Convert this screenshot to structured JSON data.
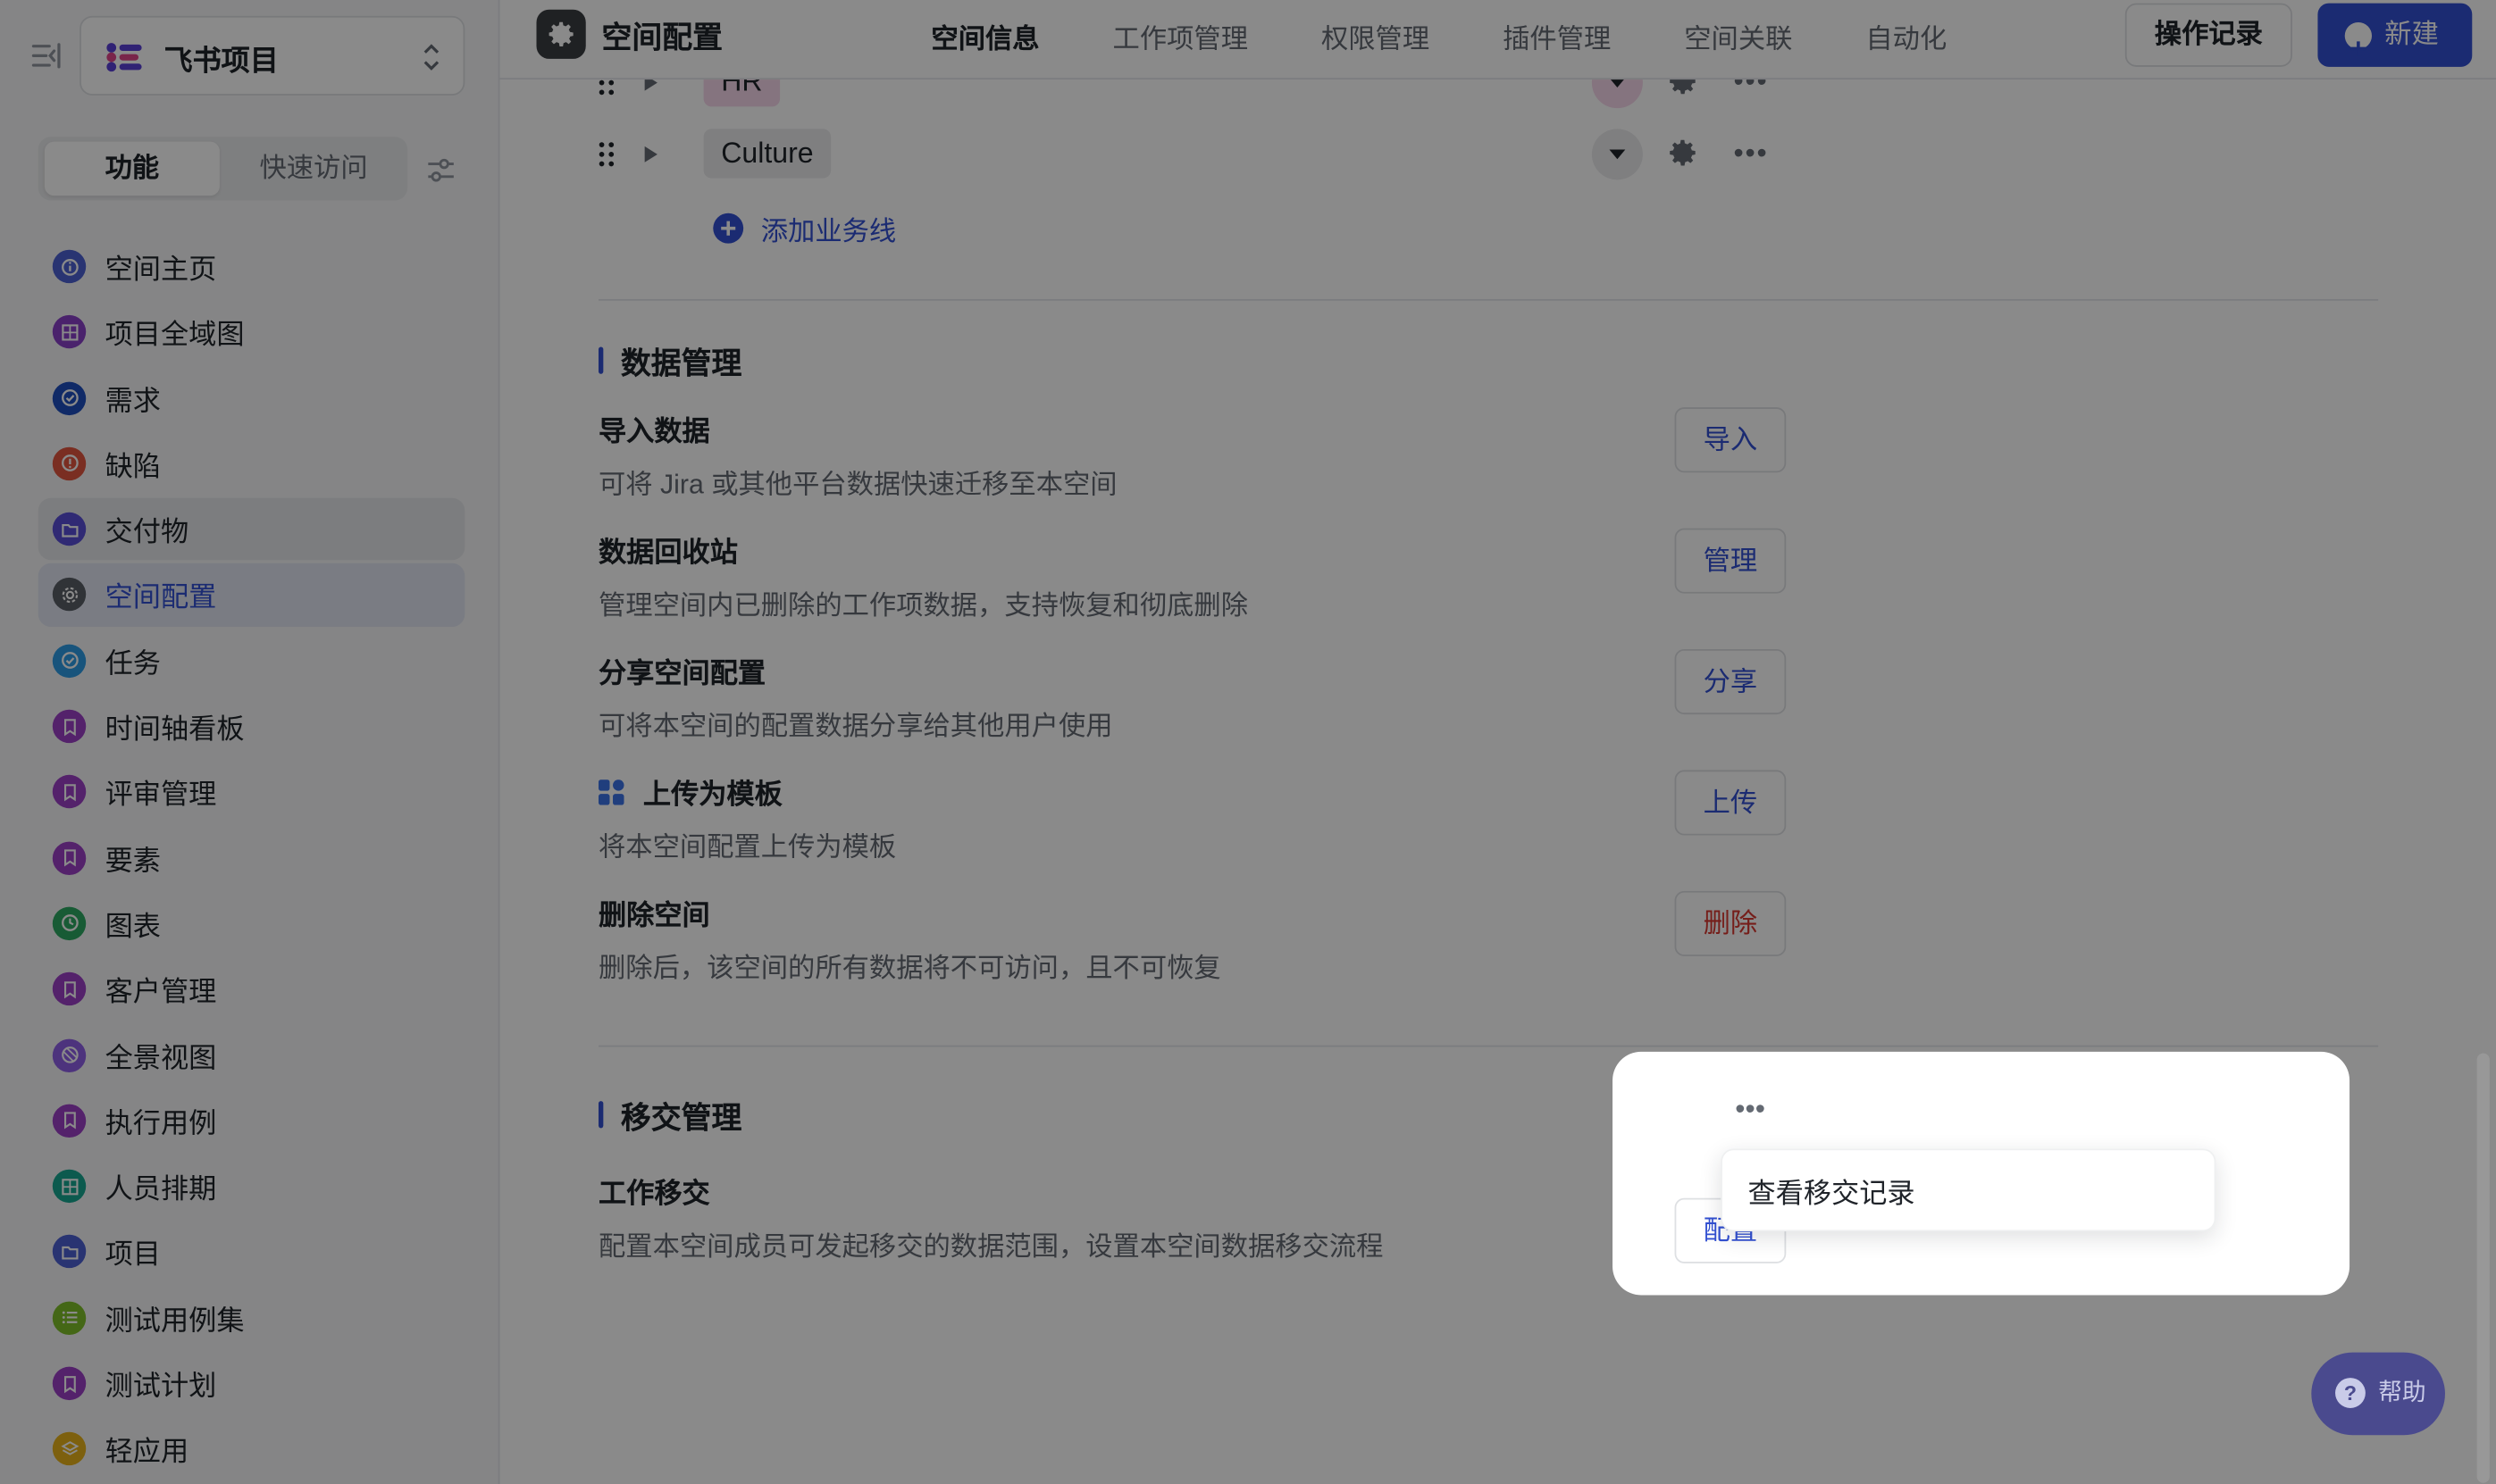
{
  "sidebar": {
    "project_name": "飞书项目",
    "segments": [
      "功能",
      "快速访问"
    ],
    "items": [
      {
        "label": "空间主页",
        "icon": "info-icon",
        "color": "#4d61d3"
      },
      {
        "label": "项目全域图",
        "icon": "grid-icon",
        "color": "#8a3fc8"
      },
      {
        "label": "需求",
        "icon": "check-circle-icon",
        "color": "#1f4fbf"
      },
      {
        "label": "缺陷",
        "icon": "alert-icon",
        "color": "#e2553f"
      },
      {
        "label": "交付物",
        "icon": "folder-icon",
        "color": "#5a4fd6"
      },
      {
        "label": "空间配置",
        "icon": "gear-icon",
        "color": "#5a5e66"
      },
      {
        "label": "任务",
        "icon": "check-circle-icon",
        "color": "#2e9ce6"
      },
      {
        "label": "时间轴看板",
        "icon": "bookmark-icon",
        "color": "#9c3fc6"
      },
      {
        "label": "评审管理",
        "icon": "bookmark-icon",
        "color": "#9c3fc6"
      },
      {
        "label": "要素",
        "icon": "bookmark-icon",
        "color": "#9c3fc6"
      },
      {
        "label": "图表",
        "icon": "clock-icon",
        "color": "#2da862"
      },
      {
        "label": "客户管理",
        "icon": "bookmark-icon",
        "color": "#9c3fc6"
      },
      {
        "label": "全景视图",
        "icon": "aperture-icon",
        "color": "#8f5fe8"
      },
      {
        "label": "执行用例",
        "icon": "bookmark-icon",
        "color": "#9c3fc6"
      },
      {
        "label": "人员排期",
        "icon": "grid-icon",
        "color": "#17a690"
      },
      {
        "label": "项目",
        "icon": "folder-icon",
        "color": "#4d61d3"
      },
      {
        "label": "测试用例集",
        "icon": "list-icon",
        "color": "#7fbf2a"
      },
      {
        "label": "测试计划",
        "icon": "bookmark-icon",
        "color": "#9c3fc6"
      },
      {
        "label": "轻应用",
        "icon": "layers-icon",
        "color": "#e8b21a"
      }
    ]
  },
  "header": {
    "title": "空间配置",
    "tabs": [
      "空间信息",
      "工作项管理",
      "权限管理",
      "插件管理",
      "空间关联",
      "自动化"
    ],
    "active_tab": "空间信息",
    "log_button": "操作记录",
    "new_button": "新建"
  },
  "business_lines": [
    {
      "name": "HR",
      "color": "#f5d7ea"
    },
    {
      "name": "Culture",
      "color": "#eaeaed"
    }
  ],
  "add_business_line": "添加业务线",
  "data_management": {
    "title": "数据管理",
    "rows": [
      {
        "title": "导入数据",
        "desc": "可将 Jira 或其他平台数据快速迁移至本空间",
        "action": "导入"
      },
      {
        "title": "数据回收站",
        "desc": "管理空间内已删除的工作项数据，支持恢复和彻底删除",
        "action": "管理"
      },
      {
        "title": "分享空间配置",
        "desc": "可将本空间的配置数据分享给其他用户使用",
        "action": "分享"
      },
      {
        "title": "上传为模板",
        "desc": "将本空间配置上传为模板",
        "action": "上传"
      },
      {
        "title": "删除空间",
        "desc": "删除后，该空间的所有数据将不可访问，且不可恢复",
        "action": "删除"
      }
    ]
  },
  "transfer_management": {
    "title": "移交管理",
    "row": {
      "title": "工作移交",
      "desc": "配置本空间成员可发起移交的数据范围，设置本空间数据移交流程",
      "action": "配置"
    },
    "more": "•••",
    "menu_item": "查看移交记录"
  },
  "help": "帮助",
  "colors": {
    "accent": "#3250d2",
    "danger": "#d83931"
  }
}
